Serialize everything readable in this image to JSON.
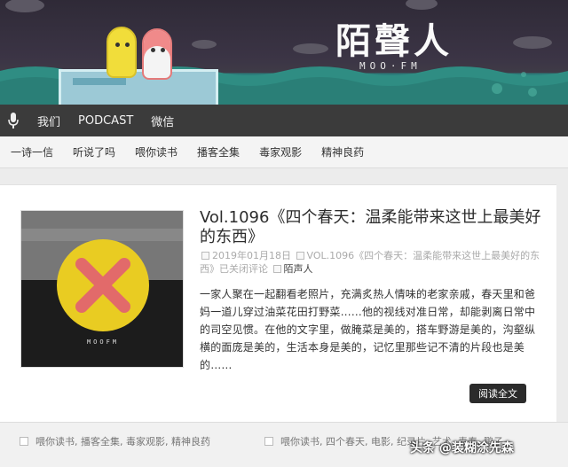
{
  "site": {
    "logo_text": "陌聲人",
    "sub_text": "MOO·FM"
  },
  "nav_main": [
    "我们",
    "PODCAST",
    "微信"
  ],
  "nav_categories": [
    "一诗一信",
    "听说了吗",
    "喂你读书",
    "播客全集",
    "毒家观影",
    "精神良药"
  ],
  "post": {
    "title": "Vol.1096《四个春天：温柔能带来这世上最美好的东西》",
    "date": "2019年01月18日",
    "comment_note": "VOL.1096《四个春天：温柔能带来这世上最美好的东西》已关闭评论",
    "author": "陌声人",
    "excerpt": "一家人聚在一起翻看老照片，充满炙热人情味的老家亲戚，春天里和爸妈一道儿穿过油菜花田打野菜……他的视线对准日常，却能剥离日常中的司空见惯。在他的文字里，做腌菜是美的，搭车野游是美的，沟壑纵横的面庞是美的，生活本身是美的，记忆里那些记不清的片段也是美的……",
    "read_more": "阅读全文",
    "thumb_label": "MOOFM"
  },
  "footer": {
    "categories": "喂你读书, 播客全集, 毒家观影, 精神良药",
    "tags": "喂你读书, 四个春天, 电影, 纪录片, 艺术, 青春, 鹏子"
  },
  "watermark": "头条 @装糊涂先森",
  "colors": {
    "banner_dark": "#3b3445",
    "banner_teal": "#2a8f86",
    "nav_dark": "#3b3b3b",
    "button": "#2b2b2b",
    "x_yellow": "#e9cc22",
    "x_red": "#e26a6a"
  }
}
